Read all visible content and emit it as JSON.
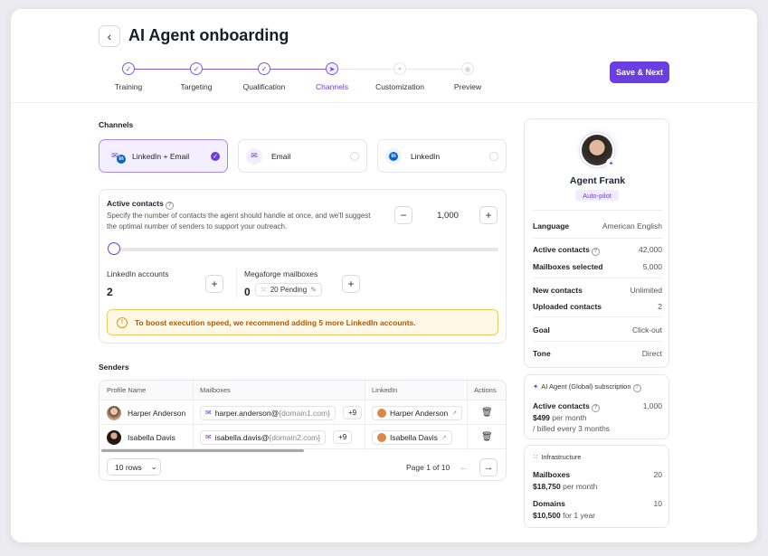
{
  "header": {
    "title": "AI Agent onboarding",
    "save_label": "Save & Next",
    "steps": [
      {
        "label": "Training",
        "state": "done"
      },
      {
        "label": "Targeting",
        "state": "done"
      },
      {
        "label": "Qualification",
        "state": "done"
      },
      {
        "label": "Channels",
        "state": "current"
      },
      {
        "label": "Customization",
        "state": "todo"
      },
      {
        "label": "Preview",
        "state": "todo"
      }
    ]
  },
  "channels": {
    "section_label": "Channels",
    "options": [
      {
        "label": "LinkedIn + Email",
        "selected": true
      },
      {
        "label": "Email",
        "selected": false
      },
      {
        "label": "LinkedIn",
        "selected": false
      }
    ]
  },
  "contacts": {
    "title": "Active contacts",
    "description": "Specify the number of contacts the agent should handle at once, and we'll suggest the optimal number of senders to support your outreach.",
    "value": "1,000",
    "slider_fraction": 0.0,
    "linkedin_label": "LinkedIn accounts",
    "linkedin_value": "2",
    "mailboxes_label": "Megaforge mailboxes",
    "mailboxes_value": "0",
    "pending_label": "20 Pending",
    "warning": "To boost execution speed, we recommend adding 5 more LinkedIn accounts."
  },
  "senders": {
    "section_label": "Senders",
    "columns": [
      "Profile Name",
      "Mailboxes",
      "LinkedIn",
      "Actions"
    ],
    "rows": [
      {
        "name": "Harper Anderson",
        "mail_user": "harper.anderson@",
        "mail_domain": "{domain1.com}",
        "extra": "+9",
        "linkedin": "Harper Anderson"
      },
      {
        "name": "Isabella Davis",
        "mail_user": "isabella.davis@",
        "mail_domain": "{domain2.com}",
        "extra": "+9",
        "linkedin": "Isabella Davis"
      }
    ],
    "rows_select": "10 rows",
    "page_info": "Page 1 of 10"
  },
  "agent": {
    "name": "Agent Frank",
    "badge": "Auto-pilot",
    "details": [
      {
        "key": "Language",
        "value": "American English"
      },
      {
        "key": "Active contacts",
        "value": "42,000"
      },
      {
        "key": "Mailboxes selected",
        "value": "5,000"
      },
      {
        "key": "New contacts",
        "value": "Unlimited"
      },
      {
        "key": "Uploaded contacts",
        "value": "2"
      },
      {
        "key": "Goal",
        "value": "Click-out"
      },
      {
        "key": "Tone",
        "value": "Direct"
      }
    ]
  },
  "subscription": {
    "title": "AI Agent (Global) subscription",
    "contacts_label": "Active contacts",
    "contacts_value": "1,000",
    "price": "$499",
    "price_suffix": " per month",
    "billing": "/ billed every 3 months"
  },
  "infrastructure": {
    "title": "Infrastructure",
    "mailboxes_label": "Mailboxes",
    "mailboxes_value": "20",
    "mailboxes_price": "$18,750",
    "mailboxes_suffix": " per month",
    "domains_label": "Domains",
    "domains_value": "10",
    "domains_price": "$10,500",
    "domains_suffix": " for 1 year"
  },
  "colors": {
    "accent": "#6a3ee0",
    "warning_bg": "#fff8e6",
    "warning_text": "#b25a00"
  }
}
